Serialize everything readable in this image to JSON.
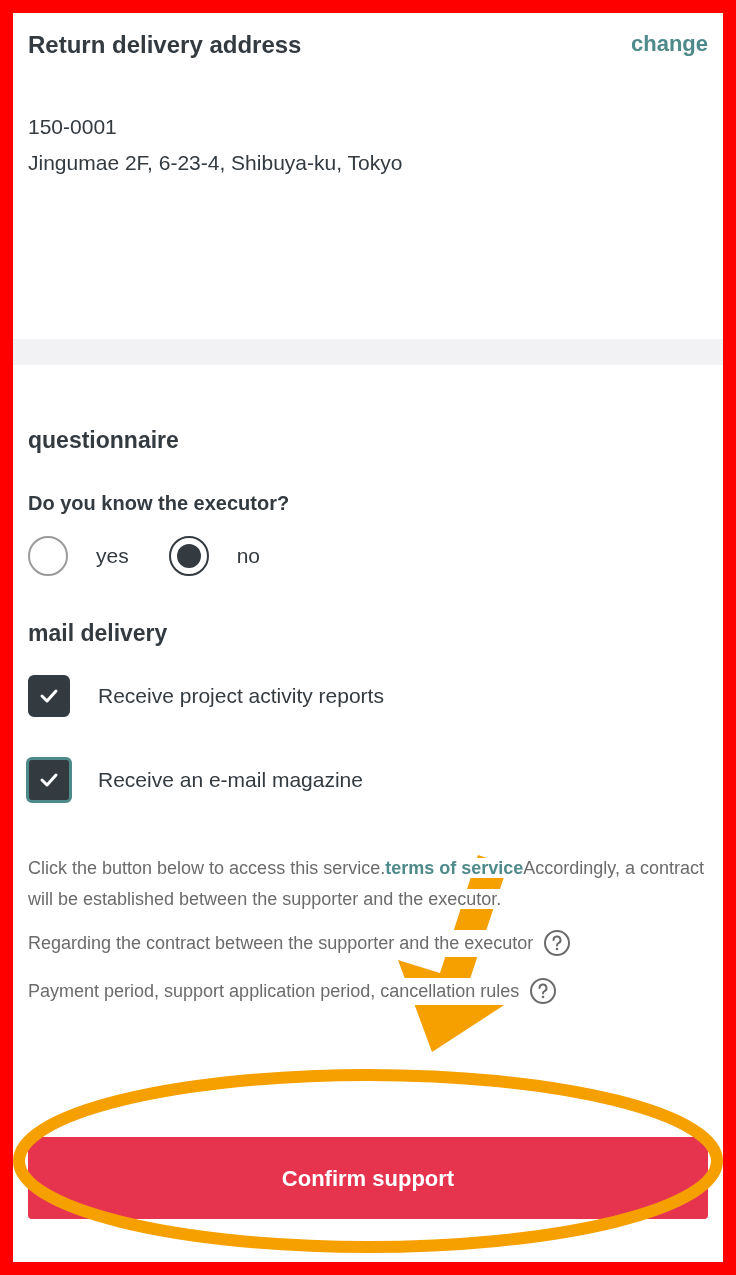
{
  "address": {
    "title": "Return delivery address",
    "change_link": "change",
    "postal_code": "150-0001",
    "line": "Jingumae 2F, 6-23-4, Shibuya-ku, Tokyo"
  },
  "questionnaire": {
    "title": "questionnaire",
    "question": "Do you know the executor?",
    "options": [
      {
        "label": "yes",
        "selected": false
      },
      {
        "label": "no",
        "selected": true
      }
    ]
  },
  "mail_delivery": {
    "title": "mail delivery",
    "items": [
      {
        "label": "Receive project activity reports",
        "checked": true,
        "focused": false
      },
      {
        "label": "Receive an e-mail magazine",
        "checked": true,
        "focused": true
      }
    ]
  },
  "notice": {
    "before": "Click the button below to access this service.",
    "link": "terms of service",
    "after": "Accordingly, a contract will be established between the supporter and the executor."
  },
  "help_links": [
    "Regarding the contract between the supporter and the executor",
    "Payment period, support application period, cancellation rules"
  ],
  "confirm_button": "Confirm support"
}
